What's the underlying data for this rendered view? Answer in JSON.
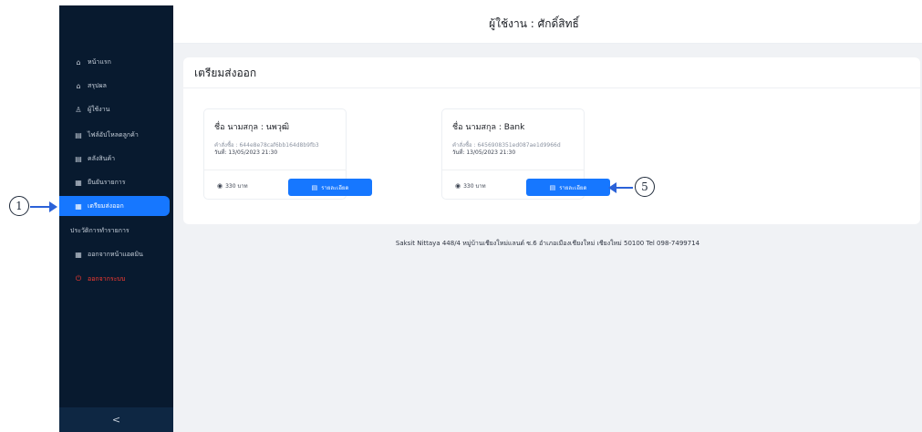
{
  "annotations": {
    "left_number": "1",
    "right_number": "5"
  },
  "topbar": {
    "user_label": "ผู้ใช้งาน : ศักดิ์สิทธิ์"
  },
  "sidebar": {
    "items": [
      {
        "label": "หน้าแรก",
        "icon": "home-icon"
      },
      {
        "label": "สรุปผล",
        "icon": "home-icon"
      },
      {
        "label": "ผู้ใช้งาน",
        "icon": "user-icon"
      },
      {
        "label": "ไฟล์อัปโหลดลูกค้า",
        "icon": "table-icon"
      },
      {
        "label": "คลังสินค้า",
        "icon": "table-icon"
      },
      {
        "label": "ยืนยันรายการ",
        "icon": "document-icon"
      },
      {
        "label": "เตรียมส่งออก",
        "icon": "document-icon"
      },
      {
        "label": "ประวัติการทำรายการ",
        "icon": ""
      },
      {
        "label": "ออกจากหน้าแอดมิน",
        "icon": "document-icon"
      },
      {
        "label": "ออกจากระบบ",
        "icon": "power-icon"
      }
    ],
    "active_index": 6,
    "collapse_label": "<"
  },
  "main": {
    "panel_title": "เตรียมส่งออก",
    "cards": [
      {
        "name": "ชื่อ นามสกุล : นพวุฒิ",
        "order_id": "คำสั่งซื้อ : 644e8e78caf6bb164d8b9fb3",
        "date": "วันที่: 13/05/2023 21:30",
        "price": "330 บาท",
        "detail_button": "รายละเอียด"
      },
      {
        "name": "ชื่อ นามสกุล : Bank",
        "order_id": "คำสั่งซื้อ : 6456908351ed087ae1d9966d",
        "date": "วันที่: 13/05/2023 21:30",
        "price": "330 บาท",
        "detail_button": "รายละเอียด"
      }
    ],
    "footer": "Saksit Nittaya 448/4 หมู่บ้านเชียงใหม่แลนด์ ซ.6 อำเภอเมืองเชียงใหม่ เชียงใหม่ 50100 Tel 098-7499714"
  },
  "colors": {
    "sidebar_bg": "#081a2f",
    "active_item": "#1677ff",
    "button": "#1677ff",
    "logout_text": "#ff3b30",
    "main_bg": "#f0f2f5"
  }
}
